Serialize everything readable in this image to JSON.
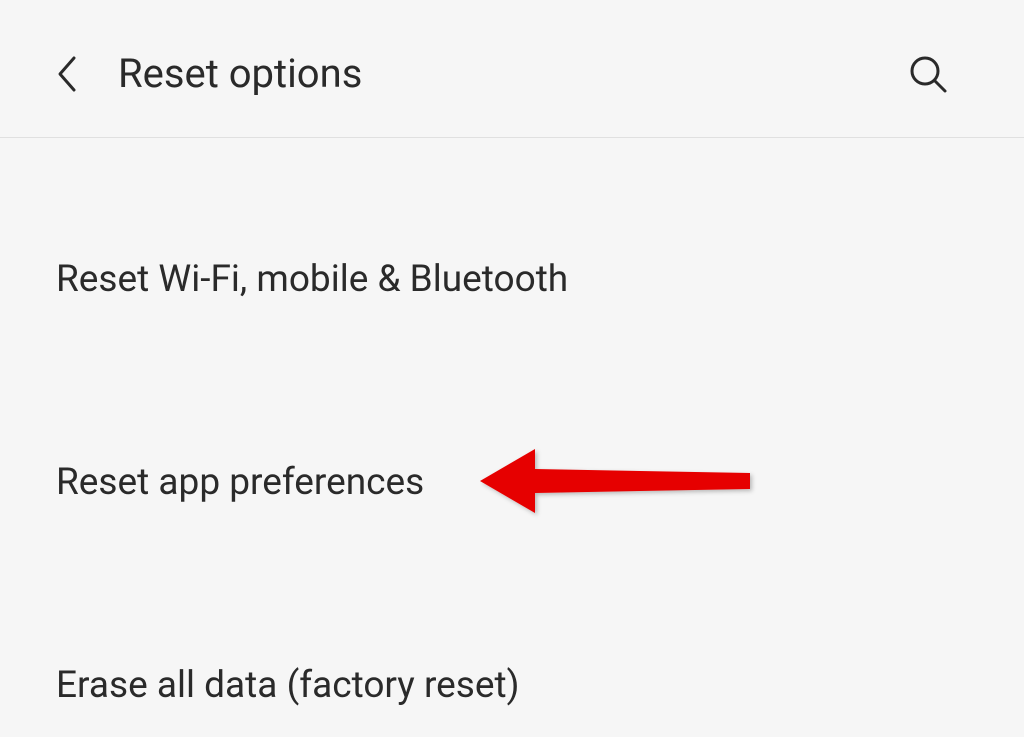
{
  "header": {
    "title": "Reset options"
  },
  "options": [
    {
      "label": "Reset Wi-Fi, mobile & Bluetooth"
    },
    {
      "label": "Reset app preferences"
    },
    {
      "label": "Erase all data (factory reset)"
    }
  ]
}
